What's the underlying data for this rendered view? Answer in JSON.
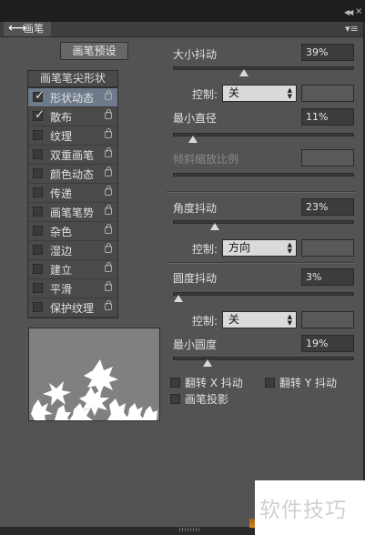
{
  "panel": {
    "tab_title": "画笔",
    "menu_icon": "panel-menu-icon",
    "preset_button": "画笔预设",
    "tip_shape_header": "画笔笔尖形状"
  },
  "options": [
    {
      "label": "形状动态",
      "checked": true,
      "selected": true
    },
    {
      "label": "散布",
      "checked": true,
      "selected": false
    },
    {
      "label": "纹理",
      "checked": false,
      "selected": false
    },
    {
      "label": "双重画笔",
      "checked": false,
      "selected": false
    },
    {
      "label": "颜色动态",
      "checked": false,
      "selected": false
    },
    {
      "label": "传递",
      "checked": false,
      "selected": false
    },
    {
      "label": "画笔笔势",
      "checked": false,
      "selected": false
    },
    {
      "label": "杂色",
      "checked": false,
      "selected": false
    },
    {
      "label": "湿边",
      "checked": false,
      "selected": false
    },
    {
      "label": "建立",
      "checked": false,
      "selected": false
    },
    {
      "label": "平滑",
      "checked": false,
      "selected": false
    },
    {
      "label": "保护纹理",
      "checked": false,
      "selected": false
    }
  ],
  "shape_dynamics": {
    "size_jitter": {
      "label": "大小抖动",
      "value": "39%",
      "level": 0.39
    },
    "control_label": "控制:",
    "size_control": "关",
    "min_diameter": {
      "label": "最小直径",
      "value": "11%",
      "level": 0.11
    },
    "tilt_scale": {
      "label": "倾斜缩放比例",
      "value": "",
      "level": 0
    },
    "angle_jitter": {
      "label": "角度抖动",
      "value": "23%",
      "level": 0.23
    },
    "angle_control": "方向",
    "roundness_jitter": {
      "label": "圆度抖动",
      "value": "3%",
      "level": 0.03
    },
    "roundness_control": "关",
    "min_roundness": {
      "label": "最小圆度",
      "value": "19%",
      "level": 0.19
    },
    "flip_x": "翻转 X 抖动",
    "flip_y": "翻转 Y 抖动",
    "brush_projection": "画笔投影"
  },
  "watermark": "软件技巧",
  "colors": {
    "panel": "#535353",
    "selected_row": "#6d7a8a",
    "accent_orange": "#d8871f"
  }
}
